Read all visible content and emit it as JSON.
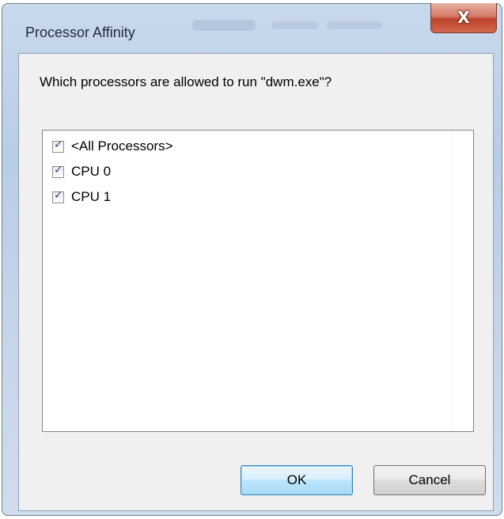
{
  "window": {
    "title": "Processor Affinity",
    "close_symbol": "X"
  },
  "dialog": {
    "prompt": "Which processors are allowed to run \"dwm.exe\"?"
  },
  "processor_list": {
    "items": [
      {
        "label": "<All Processors>",
        "checked": true
      },
      {
        "label": "CPU 0",
        "checked": true
      },
      {
        "label": "CPU 1",
        "checked": true
      }
    ]
  },
  "buttons": {
    "ok_label": "OK",
    "cancel_label": "Cancel"
  },
  "colors": {
    "frame": "#c4d4e8",
    "close_button": "#c0422c",
    "ok_highlight": "#3c7fb1"
  }
}
